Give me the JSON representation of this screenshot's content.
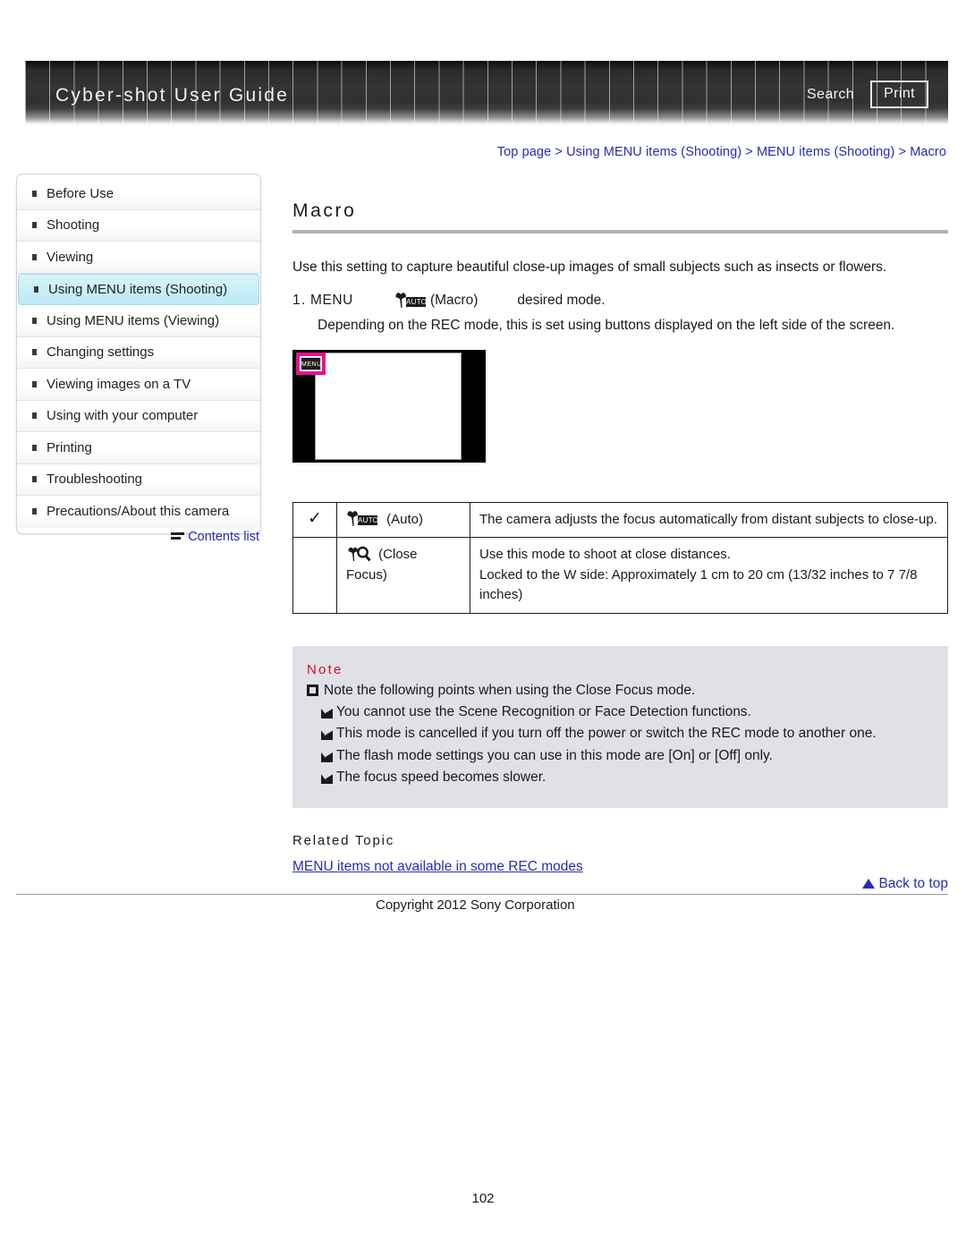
{
  "header": {
    "title": "Cyber-shot User Guide",
    "search_label": "Search",
    "print_label": "Print"
  },
  "breadcrumb": {
    "text": "Top page > Using MENU items (Shooting) > MENU items (Shooting) > Macro"
  },
  "sidebar": {
    "items": [
      {
        "label": "Before Use",
        "active": false
      },
      {
        "label": "Shooting",
        "active": false
      },
      {
        "label": "Viewing",
        "active": false
      },
      {
        "label": "Using MENU items (Shooting)",
        "active": true
      },
      {
        "label": "Using MENU items (Viewing)",
        "active": false
      },
      {
        "label": "Changing settings",
        "active": false
      },
      {
        "label": "Viewing images on a TV",
        "active": false
      },
      {
        "label": "Using with your computer",
        "active": false
      },
      {
        "label": "Printing",
        "active": false
      },
      {
        "label": "Troubleshooting",
        "active": false
      },
      {
        "label": "Precautions/About this camera",
        "active": false
      }
    ],
    "contents_list_label": "Contents list"
  },
  "main": {
    "title": "Macro",
    "intro": "Use this setting to capture beautiful close-up images of small subjects such as insects or flowers.",
    "step": {
      "number": "1.",
      "menu_label": "MENU",
      "icon_label": "(Macro)",
      "icon_auto_text": "AUTO",
      "tail": "desired mode."
    },
    "step_note": "Depending on the REC mode, this is set using buttons displayed on the left side of the screen.",
    "illustration": {
      "menu_button_label": "MENU"
    },
    "table": {
      "rows": [
        {
          "checked": "✓",
          "mode": "(Auto)",
          "icon_text": "AUTO",
          "description": "The camera adjusts the focus automatically from distant subjects to close-up."
        },
        {
          "checked": "",
          "mode": "(Close Focus)",
          "icon_text": "",
          "description_line1": "Use this mode to shoot at close distances.",
          "description_line2": "Locked to the W side: Approximately 1 cm to 20 cm (13/32 inches to 7 7/8 inches)"
        }
      ]
    },
    "note": {
      "title": "Note",
      "lead": "Note the following points when using the Close Focus mode.",
      "items": [
        "You cannot use the Scene Recognition or Face Detection functions.",
        "This mode is cancelled if you turn off the power or switch the REC mode to another one.",
        "The flash mode settings you can use in this mode are [On] or [Off] only.",
        "The focus speed becomes slower."
      ]
    },
    "related": {
      "title": "Related Topic",
      "link": "MENU items not available in some REC modes"
    }
  },
  "footer": {
    "back_to_top": "Back to top",
    "copyright": "Copyright 2012 Sony Corporation",
    "page_number": "102"
  },
  "colors": {
    "link": "#2a2ab5",
    "accent_pink": "#ec0f8e",
    "note_red": "#d4121a",
    "active_nav": "#c9eef8"
  }
}
